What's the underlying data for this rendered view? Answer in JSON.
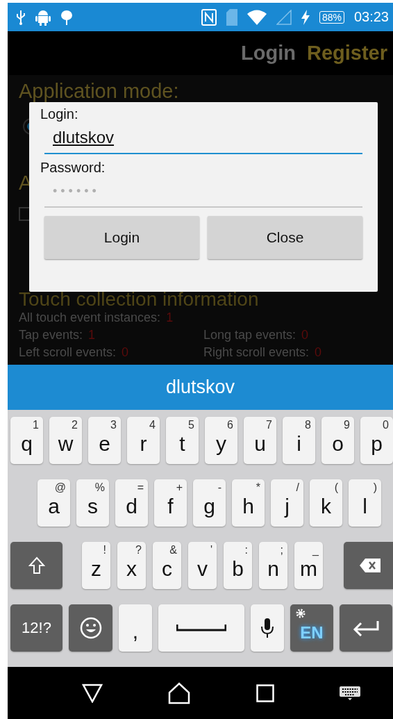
{
  "status_bar": {
    "battery": "88%",
    "time": "03:23"
  },
  "app_bar": {
    "tabs": [
      {
        "label": "Login",
        "selected": false
      },
      {
        "label": "Register",
        "selected": true
      }
    ]
  },
  "content": {
    "mode_title": "Application mode:",
    "mode_radio": {
      "selected": true
    },
    "section_title": "A",
    "section_checkbox": {
      "checked": false
    },
    "touch_title": "Touch collection information",
    "stats": [
      {
        "label": "All touch event instances:",
        "value": "1"
      },
      {
        "label": "Tap events:",
        "value": "1"
      },
      {
        "label": "Long tap events:",
        "value": "0"
      },
      {
        "label": "Left scroll events:",
        "value": "0"
      },
      {
        "label": "Right scroll events:",
        "value": "0"
      }
    ]
  },
  "dialog": {
    "login_label": "Login:",
    "login_value": "dlutskov",
    "password_label": "Password:",
    "password_placeholder": "••••••",
    "buttons": [
      "Login",
      "Close"
    ]
  },
  "suggestion": "dlutskov",
  "keyboard": [
    [
      {
        "kind": "letter",
        "label": "q",
        "hint": "1"
      },
      {
        "kind": "letter",
        "label": "w",
        "hint": "2"
      },
      {
        "kind": "letter",
        "label": "e",
        "hint": "3"
      },
      {
        "kind": "letter",
        "label": "r",
        "hint": "4"
      },
      {
        "kind": "letter",
        "label": "t",
        "hint": "5"
      },
      {
        "kind": "letter",
        "label": "y",
        "hint": "6"
      },
      {
        "kind": "letter",
        "label": "u",
        "hint": "7"
      },
      {
        "kind": "letter",
        "label": "i",
        "hint": "8"
      },
      {
        "kind": "letter",
        "label": "o",
        "hint": "9"
      },
      {
        "kind": "letter",
        "label": "p",
        "hint": "0"
      }
    ],
    [
      {
        "kind": "letter",
        "label": "a",
        "hint": "@"
      },
      {
        "kind": "letter",
        "label": "s",
        "hint": "%"
      },
      {
        "kind": "letter",
        "label": "d",
        "hint": "="
      },
      {
        "kind": "letter",
        "label": "f",
        "hint": "+"
      },
      {
        "kind": "letter",
        "label": "g",
        "hint": "-"
      },
      {
        "kind": "letter",
        "label": "h",
        "hint": "*"
      },
      {
        "kind": "letter",
        "label": "j",
        "hint": "/"
      },
      {
        "kind": "letter",
        "label": "k",
        "hint": "("
      },
      {
        "kind": "letter",
        "label": "l",
        "hint": ")"
      }
    ],
    [
      {
        "kind": "shift"
      },
      {
        "kind": "letter",
        "label": "z",
        "hint": "!"
      },
      {
        "kind": "letter",
        "label": "x",
        "hint": "?"
      },
      {
        "kind": "letter",
        "label": "c",
        "hint": "&"
      },
      {
        "kind": "letter",
        "label": "v",
        "hint": "'"
      },
      {
        "kind": "letter",
        "label": "b",
        "hint": ":"
      },
      {
        "kind": "letter",
        "label": "n",
        "hint": ";"
      },
      {
        "kind": "letter",
        "label": "m",
        "hint": "_"
      },
      {
        "kind": "backspace"
      }
    ],
    [
      {
        "kind": "symbols",
        "label": "12!?"
      },
      {
        "kind": "emoji"
      },
      {
        "kind": "letter",
        "label": ","
      },
      {
        "kind": "space"
      },
      {
        "kind": "mic"
      },
      {
        "kind": "language",
        "label": "EN"
      },
      {
        "kind": "enter"
      }
    ]
  ]
}
